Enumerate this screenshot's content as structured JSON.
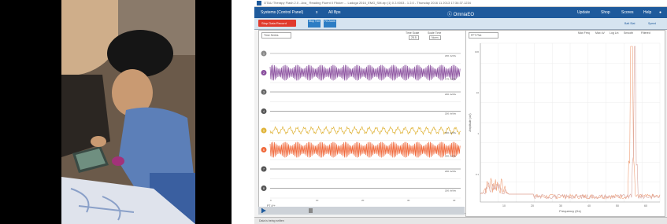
{
  "window": {
    "title": "OTAU Therapy Flash 2.0 - Ava_ Reading Fluent 0 Flicker ... Ladoga 2016_EMG_SM.zip (1) 0 2.0003 - 1 2.0 - Thursday 2016 11 2013 17:34:37.1234",
    "brand": "ⓒ OmniaEO"
  },
  "menu": {
    "left": [
      "Systems (Control Panel)",
      "x",
      "All Bps"
    ],
    "right": [
      "Update",
      "Shop",
      "Scores",
      "Help",
      "●"
    ]
  },
  "toolbar": {
    "record_button": "Stop Data Record",
    "buttons": [
      "Stop Tmr",
      "Fit Zoom"
    ],
    "right_links": [
      "Batt Stat",
      "Speed"
    ]
  },
  "left_panel": {
    "dropdown": "Time Series",
    "controls": [
      "Time Scale",
      "25.5",
      "Scale Time",
      "Norm"
    ],
    "x_ticks": [
      "0",
      "10",
      "20",
      "30",
      "40"
    ],
    "time_start": "PT 4*+"
  },
  "channels": [
    {
      "num": "1",
      "color": "#8a8a8a",
      "kind": "flat",
      "right_label": "200 uV/div"
    },
    {
      "num": "2",
      "color": "#8a4f9e",
      "kind": "dense",
      "right_label": "175 uV/div",
      "scale": "500 uV/div"
    },
    {
      "num": "3",
      "color": "#666666",
      "kind": "flat",
      "right_label": "200 uV/div"
    },
    {
      "num": "4",
      "color": "#555555",
      "kind": "flat",
      "right_label": "200 uV/div"
    },
    {
      "num": "5",
      "color": "#e0b43a",
      "kind": "wave",
      "right_label": "200 uV/div"
    },
    {
      "num": "6",
      "color": "#f0683a",
      "kind": "dense",
      "right_label": "200 uV/div"
    },
    {
      "num": "7",
      "color": "#555555",
      "kind": "flat",
      "right_label": "200 uV/div"
    },
    {
      "num": "8",
      "color": "#555555",
      "kind": "flat",
      "right_label": "200 uV/div"
    }
  ],
  "right_panel": {
    "dropdown": "FFT Plot",
    "controls": [
      "Max Freq",
      "Max uV",
      "Log Lin",
      "Smooth",
      "Filtered"
    ],
    "x_axis_label": "Frequency (Hz)",
    "y_axis_label": "Amplitude (uV)",
    "x_ticks": [
      "10",
      "20",
      "30",
      "40",
      "50",
      "60"
    ],
    "y_ticks": [
      "100",
      "10",
      "1",
      "0.1"
    ]
  },
  "statusbar": {
    "text": "Data is being written"
  },
  "colors": {
    "accent": "#1e5a9c",
    "record": "#e03a2e",
    "ch_purple": "#8a4f9e",
    "ch_yellow": "#e0b43a",
    "ch_orange": "#f0683a"
  }
}
